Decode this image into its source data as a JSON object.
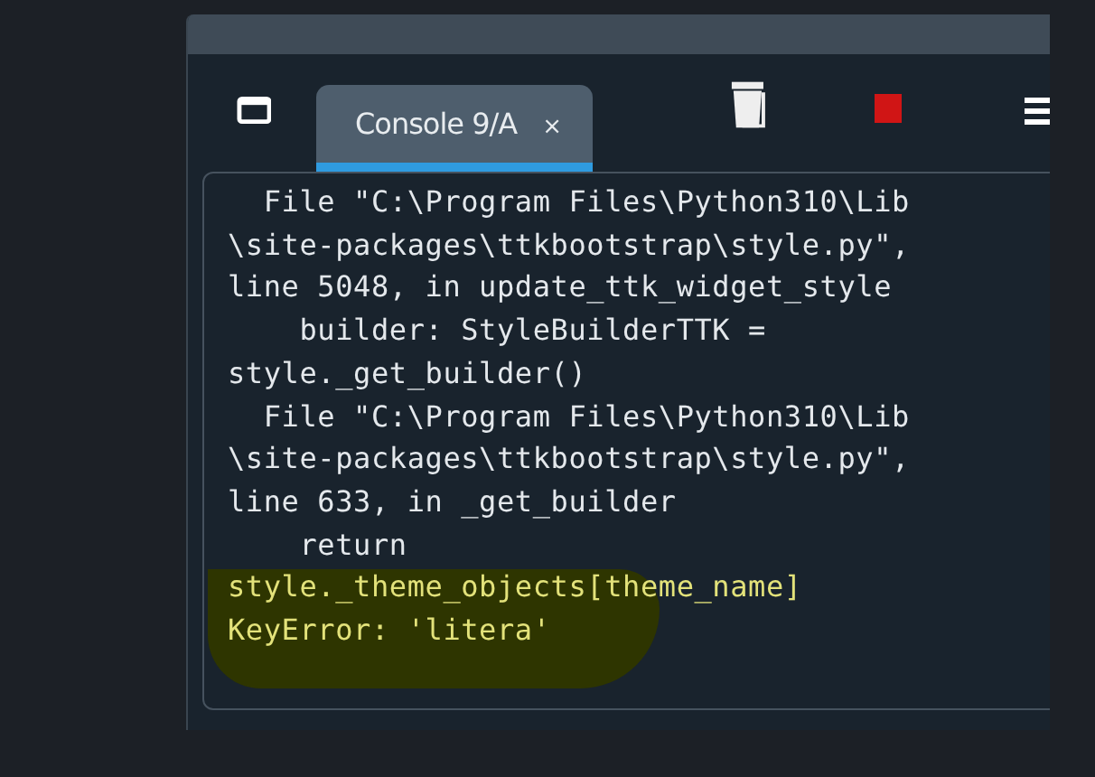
{
  "tab": {
    "label": "Console 9/A",
    "close": "×",
    "selected": true
  },
  "console_lines": [
    {
      "text": "  File \"C:\\Program Files\\Python310\\Lib",
      "highlighted": false
    },
    {
      "text": "\\site-packages\\ttkbootstrap\\style.py\",",
      "highlighted": false
    },
    {
      "text": "line 5048, in update_ttk_widget_style",
      "highlighted": false
    },
    {
      "text": "    builder: StyleBuilderTTK =",
      "highlighted": false
    },
    {
      "text": "style._get_builder()",
      "highlighted": false
    },
    {
      "text": "  File \"C:\\Program Files\\Python310\\Lib",
      "highlighted": false
    },
    {
      "text": "\\site-packages\\ttkbootstrap\\style.py\",",
      "highlighted": false
    },
    {
      "text": "line 633, in _get_builder",
      "highlighted": false
    },
    {
      "text": "    return",
      "highlighted": false
    },
    {
      "text": "style._theme_objects[theme_name]",
      "highlighted": true
    },
    {
      "text": "KeyError: 'litera'",
      "highlighted": true
    }
  ]
}
